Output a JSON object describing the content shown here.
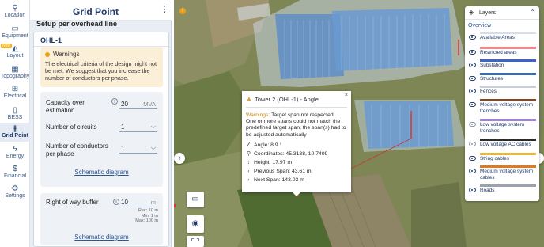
{
  "nav": {
    "items": [
      {
        "label": "Location",
        "icon": "pin-icon",
        "glyph": "⚲"
      },
      {
        "label": "Equipment",
        "icon": "monitor-icon",
        "glyph": "▭",
        "badge": "New"
      },
      {
        "label": "Layout",
        "icon": "layout-icon",
        "glyph": "◭"
      },
      {
        "label": "Topography",
        "icon": "topography-icon",
        "glyph": "▦"
      },
      {
        "label": "Electrical",
        "icon": "electrical-icon",
        "glyph": "⊞"
      },
      {
        "label": "BESS",
        "icon": "battery-icon",
        "glyph": "▯"
      },
      {
        "label": "Grid Point",
        "icon": "tower-icon",
        "glyph": "⫲"
      },
      {
        "label": "Energy",
        "icon": "bolt-icon",
        "glyph": "ϟ"
      },
      {
        "label": "Financial",
        "icon": "dollar-icon",
        "glyph": "$"
      },
      {
        "label": "Settings",
        "icon": "gear-icon",
        "glyph": "⚙"
      }
    ]
  },
  "panel": {
    "title": "Grid Point",
    "section_label": "Setup per overhead line",
    "line_name": "OHL-1",
    "warning": {
      "title": "Warnings",
      "text": "The electrical criteria of the design might not be met. We suggest that you increase the number of conductors per phase."
    },
    "capacity": {
      "label": "Capacity over estimation",
      "value": "20",
      "unit": "MVA"
    },
    "circuits": {
      "label": "Number of circuits",
      "value": "1"
    },
    "conductors": {
      "label": "Number of conductors per phase",
      "value": "1"
    },
    "schematic_link": "Schematic diagram",
    "row": {
      "label": "Right of way buffer",
      "value": "10",
      "unit": "m",
      "rec": "Rec: 10 m",
      "min": "Min: 1 m",
      "max": "Max: 100 m"
    },
    "schematic_link_2": "Schematic diagram"
  },
  "popup": {
    "title": "Tower 2 (OHL-1) - Angle",
    "close": "×",
    "warning_label": "Warnings:",
    "warning_head": "Target span not respected",
    "warning_text": "One or more spans could not match the predefined target span; the span(s) had to be adjusted automatically",
    "angle": "Angle: 8.9 °",
    "coordinates": "Coordinates: 45.3138, 10.7409",
    "height": "Height: 17.97 m",
    "previous_span": "Previous Span: 43.61 m",
    "next_span": "Next Span: 143.03 m"
  },
  "layers": {
    "title": "Layers",
    "overview": "Overview",
    "items": [
      {
        "name": "Available Areas",
        "color": "#d9dee5",
        "visible": true
      },
      {
        "name": "Restricted areas",
        "color": "#f08a8a",
        "visible": true
      },
      {
        "name": "Substation",
        "color": "#3d63c9",
        "visible": true
      },
      {
        "name": "Structures",
        "color": "#3b6fb3",
        "visible": true
      },
      {
        "name": "Fences",
        "color": "#c9ced6",
        "visible": true
      },
      {
        "name": "Medium voltage system trenches",
        "color": "#7a4a2a",
        "visible": true
      },
      {
        "name": "Low voltage system trenches",
        "color": "#a084d6",
        "visible": false
      },
      {
        "name": "Low voltage AC cables",
        "color": "#2b2b2b",
        "visible": false
      },
      {
        "name": "String cables",
        "color": "#e9b93a",
        "visible": true
      },
      {
        "name": "Medium voltage system cables",
        "color": "#e07a20",
        "visible": true
      },
      {
        "name": "Roads",
        "color": "#9aa2ab",
        "visible": true
      }
    ]
  },
  "map_controls": {
    "ruler": "ruler-icon",
    "locate": "crosshair-icon",
    "fullscreen": "fullscreen-icon"
  }
}
